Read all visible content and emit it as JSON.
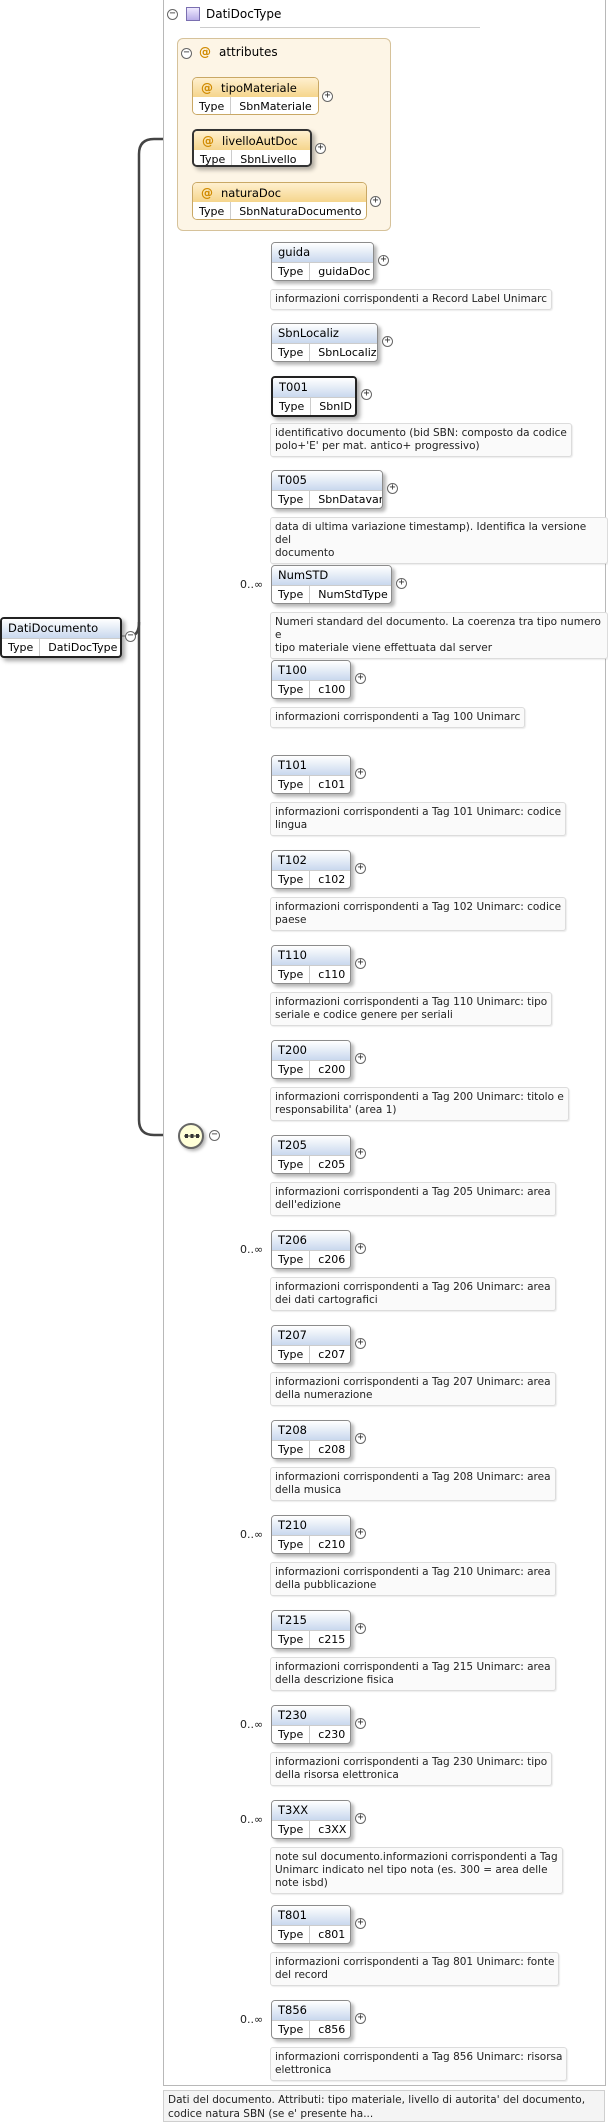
{
  "type_header": {
    "name": "DatiDocType",
    "icon": "complex-type-icon"
  },
  "type_label": "Type",
  "root": {
    "name": "DatiDocumento",
    "type": "DatiDocType"
  },
  "attributes_group": {
    "label": "attributes"
  },
  "attributes": [
    {
      "name": "tipoMateriale",
      "type": "SbnMateriale"
    },
    {
      "name": "livelloAutDoc",
      "type": "SbnLivello"
    },
    {
      "name": "naturaDoc",
      "type": "SbnNaturaDocumento"
    }
  ],
  "elements": [
    {
      "name": "guida",
      "type": "guidaDoc",
      "occurrence": "",
      "desc": [
        "informazioni corrispondenti a Record Label Unimarc"
      ]
    },
    {
      "name": "SbnLocaliz",
      "type": "SbnLocaliz",
      "occurrence": "",
      "desc": []
    },
    {
      "name": "T001",
      "type": "SbnID",
      "occurrence": "",
      "desc": [
        "identificativo documento (bid SBN: composto da codice",
        "polo+'E' per mat. antico+ progressivo)"
      ]
    },
    {
      "name": "T005",
      "type": "SbnDatavar",
      "occurrence": "",
      "desc": [
        "data di ultima variazione timestamp). Identifica la versione del",
        "documento"
      ]
    },
    {
      "name": "NumSTD",
      "type": "NumStdType",
      "occurrence": "0..∞",
      "desc": [
        "Numeri standard del documento. La coerenza tra tipo numero e",
        "tipo materiale viene effettuata dal server"
      ]
    },
    {
      "name": "T100",
      "type": "c100",
      "occurrence": "",
      "desc": [
        "informazioni corrispondenti a Tag 100 Unimarc"
      ]
    },
    {
      "name": "T101",
      "type": "c101",
      "occurrence": "",
      "desc": [
        "informazioni corrispondenti a Tag 101 Unimarc: codice",
        "lingua"
      ]
    },
    {
      "name": "T102",
      "type": "c102",
      "occurrence": "",
      "desc": [
        "informazioni corrispondenti a Tag 102 Unimarc: codice",
        "paese"
      ]
    },
    {
      "name": "T110",
      "type": "c110",
      "occurrence": "",
      "desc": [
        "informazioni corrispondenti a Tag 110 Unimarc: tipo",
        "seriale e codice genere per seriali"
      ]
    },
    {
      "name": "T200",
      "type": "c200",
      "occurrence": "",
      "desc": [
        "informazioni corrispondenti a Tag 200 Unimarc: titolo e",
        "responsabilita' (area 1)"
      ]
    },
    {
      "name": "T205",
      "type": "c205",
      "occurrence": "",
      "desc": [
        "informazioni corrispondenti a Tag 205 Unimarc: area",
        "dell'edizione"
      ]
    },
    {
      "name": "T206",
      "type": "c206",
      "occurrence": "0..∞",
      "desc": [
        "informazioni corrispondenti a Tag 206 Unimarc: area",
        "dei dati cartografici"
      ]
    },
    {
      "name": "T207",
      "type": "c207",
      "occurrence": "",
      "desc": [
        "informazioni corrispondenti a Tag 207 Unimarc: area",
        "della numerazione"
      ]
    },
    {
      "name": "T208",
      "type": "c208",
      "occurrence": "",
      "desc": [
        "informazioni corrispondenti a Tag 208 Unimarc: area",
        "della musica"
      ]
    },
    {
      "name": "T210",
      "type": "c210",
      "occurrence": "0..∞",
      "desc": [
        "informazioni corrispondenti a Tag 210 Unimarc: area",
        "della pubblicazione"
      ]
    },
    {
      "name": "T215",
      "type": "c215",
      "occurrence": "",
      "desc": [
        "informazioni corrispondenti a Tag 215 Unimarc: area",
        "della descrizione fisica"
      ]
    },
    {
      "name": "T230",
      "type": "c230",
      "occurrence": "0..∞",
      "desc": [
        "informazioni corrispondenti a Tag 230 Unimarc: tipo",
        "della risorsa elettronica"
      ]
    },
    {
      "name": "T3XX",
      "type": "c3XX",
      "occurrence": "0..∞",
      "desc": [
        "note sul documento.informazioni corrispondenti a Tag",
        "Unimarc indicato nel tipo nota (es. 300 = area delle",
        "note isbd)"
      ]
    },
    {
      "name": "T801",
      "type": "c801",
      "occurrence": "",
      "desc": [
        "informazioni corrispondenti a Tag 801 Unimarc: fonte",
        "del record"
      ]
    },
    {
      "name": "T856",
      "type": "c856",
      "occurrence": "0..∞",
      "desc": [
        "informazioni corrispondenti a Tag 856 Unimarc: risorsa",
        "elettronica"
      ]
    }
  ],
  "bottom_note": "Dati del documento. Attributi: tipo materiale, livello di autorita' del documento, codice natura SBN (se e' presente ha..."
}
